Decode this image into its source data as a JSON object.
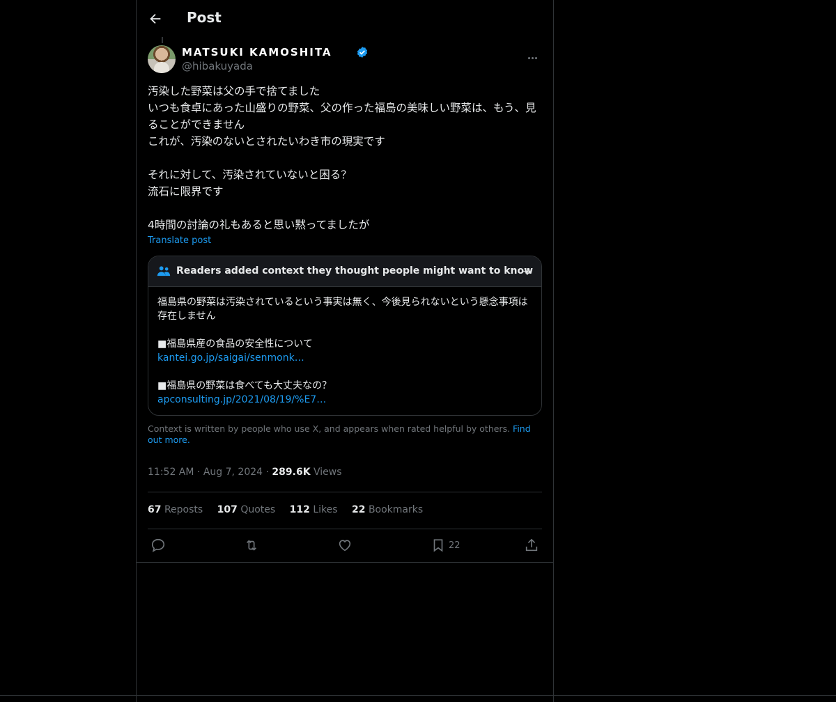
{
  "header": {
    "title": "Post"
  },
  "author": {
    "display_name": "MATSUKI KAMOSHITA",
    "handle": "@hibakuyada",
    "verified": true
  },
  "post": {
    "lines": [
      "汚染した野菜は父の手で捨てました",
      "いつも食卓にあった山盛りの野菜、父の作った福島の美味しい野菜は、もう、見ることができません",
      "これが、汚染のないとされたいわき市の現実です",
      "",
      "それに対して、汚染されていないと困る？",
      "流石に限界です",
      "",
      "4時間の討論の礼もあると思い黙ってましたが"
    ],
    "translate_label": "Translate post"
  },
  "community_note": {
    "title": "Readers added context they thought people might want to know",
    "body_line1": "福島県の野菜は汚染されているという事実は無く、今後見られないという懸念事項は存在しません",
    "ref1_title": "■福島県産の食品の安全性について",
    "ref1_link": "kantei.go.jp/saigai/senmonk…",
    "ref2_title": "■福島県の野菜は食べても大丈夫なの？",
    "ref2_link": "apconsulting.jp/2021/08/19/%E7…",
    "footer_text": "Context is written by people who use X, and appears when rated helpful by others.",
    "footer_link": "Find out more."
  },
  "meta": {
    "time": "11:52 AM",
    "date": "Aug 7, 2024",
    "views_count": "289.6K",
    "views_label": "Views",
    "separator": "·"
  },
  "stats": {
    "reposts_count": "67",
    "reposts_label": "Reposts",
    "quotes_count": "107",
    "quotes_label": "Quotes",
    "likes_count": "112",
    "likes_label": "Likes",
    "bookmarks_count": "22",
    "bookmarks_label": "Bookmarks"
  },
  "actions": {
    "bookmark_count": "22",
    "icons": [
      "reply-icon",
      "repost-icon",
      "like-icon",
      "bookmark-icon",
      "share-icon"
    ]
  },
  "colors": {
    "background": "#000000",
    "text": "#e7e9ea",
    "secondary": "#71767b",
    "accent": "#1d9bf0",
    "border": "#2f3336"
  }
}
